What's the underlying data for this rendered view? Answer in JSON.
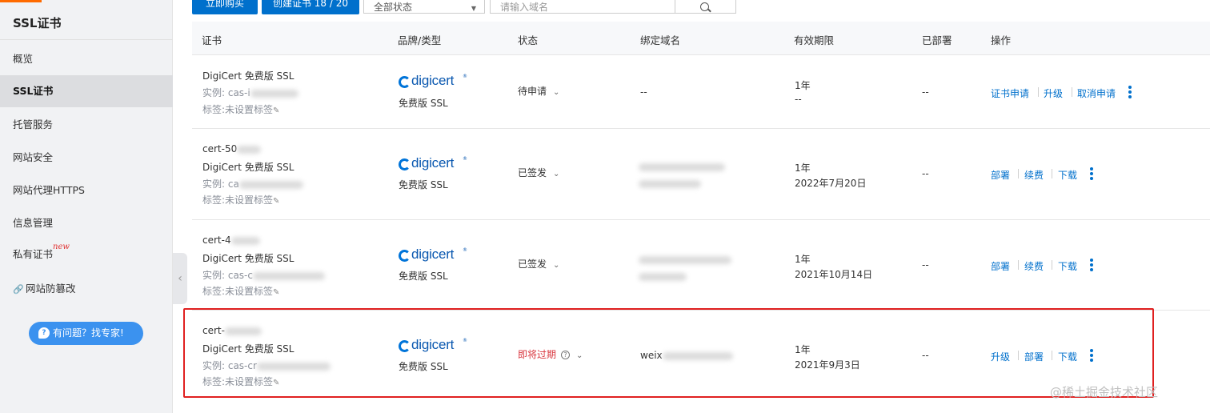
{
  "sidebar": {
    "title": "SSL证书",
    "items": [
      {
        "label": "概览"
      },
      {
        "label": "SSL证书"
      },
      {
        "label": "托管服务"
      },
      {
        "label": "网站安全"
      },
      {
        "label": "网站代理HTTPS"
      },
      {
        "label": "信息管理"
      },
      {
        "label": "私有证书"
      },
      {
        "label": "网站防篡改"
      }
    ],
    "new_badge": "new",
    "help_button": "有问题？找专家!"
  },
  "toolbar": {
    "buy_button": "立即购买",
    "create_button": "创建证书 18 / 20",
    "status_filter": "全部状态",
    "search_placeholder": "请输入域名"
  },
  "table": {
    "headers": [
      "证书",
      "品牌/类型",
      "状态",
      "绑定域名",
      "有效期限",
      "已部署",
      "操作"
    ],
    "rows": [
      {
        "cert_id": "",
        "cert_name": "DigiCert 免费版 SSL",
        "instance": "实例: cas-i",
        "tag": "标签:未设置标签",
        "brand": "digicert",
        "brand_type": "免费版 SSL",
        "status": "待申请",
        "domain": "--",
        "validity": "1年",
        "expiry": "--",
        "deployed": "--",
        "actions": [
          "证书申请",
          "升级",
          "取消申请"
        ]
      },
      {
        "cert_id": "cert-50",
        "cert_name": "DigiCert 免费版 SSL",
        "instance": "实例: ca",
        "tag": "标签:未设置标签",
        "brand": "digicert",
        "brand_type": "免费版 SSL",
        "status": "已签发",
        "domain": "",
        "validity": "1年",
        "expiry": "2022年7月20日",
        "deployed": "--",
        "actions": [
          "部署",
          "续费",
          "下载"
        ]
      },
      {
        "cert_id": "cert-4",
        "cert_name": "DigiCert 免费版 SSL",
        "instance": "实例: cas-c",
        "tag": "标签:未设置标签",
        "brand": "digicert",
        "brand_type": "免费版 SSL",
        "status": "已签发",
        "domain": "",
        "validity": "1年",
        "expiry": "2021年10月14日",
        "deployed": "--",
        "actions": [
          "部署",
          "续费",
          "下载"
        ]
      },
      {
        "cert_id": "cert-",
        "cert_name": "DigiCert 免费版 SSL",
        "instance": "实例: cas-cr",
        "tag": "标签:未设置标签",
        "brand": "digicert",
        "brand_type": "免费版 SSL",
        "status": "即将过期",
        "domain": "weix",
        "validity": "1年",
        "expiry": "2021年9月3日",
        "deployed": "--",
        "actions": [
          "升级",
          "部署",
          "下载"
        ]
      }
    ]
  },
  "watermark": "@稀土掘金技术社区",
  "colors": {
    "primary": "#0070cc",
    "danger": "#d9363e",
    "highlight": "#e02020",
    "accent": "#ff6a00"
  }
}
